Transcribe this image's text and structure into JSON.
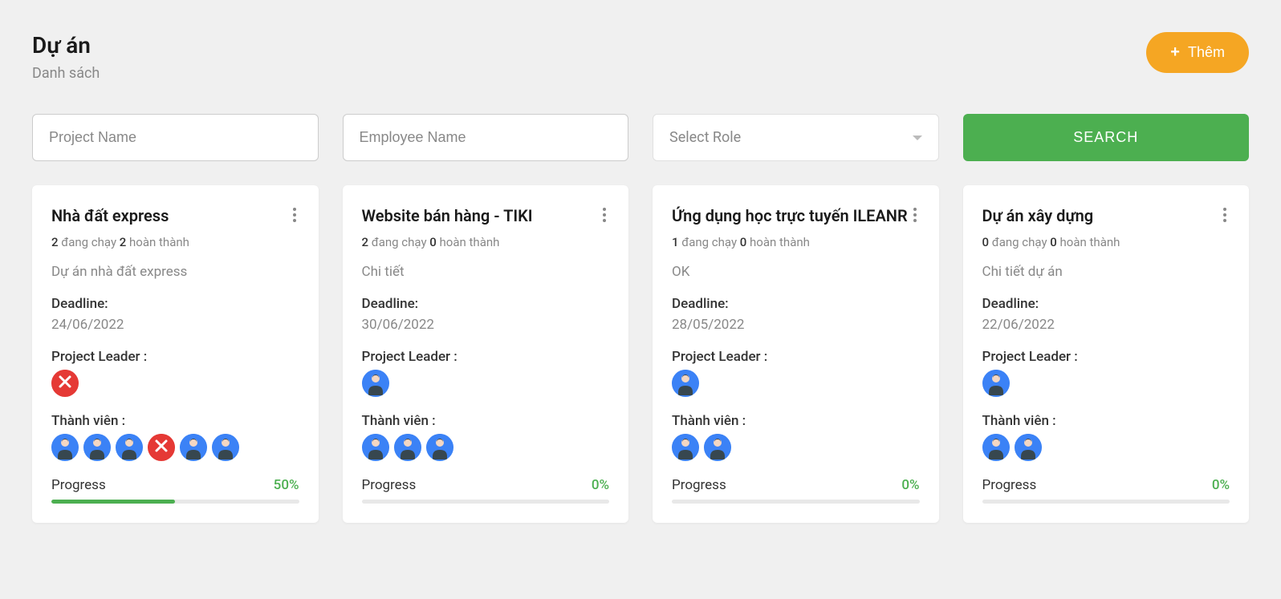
{
  "header": {
    "title": "Dự án",
    "subtitle": "Danh sách",
    "add_button": "Thêm"
  },
  "filters": {
    "project_name_placeholder": "Project Name",
    "employee_name_placeholder": "Employee Name",
    "role_placeholder": "Select Role",
    "search_button": "SEARCH"
  },
  "labels": {
    "deadline": "Deadline:",
    "project_leader": "Project Leader :",
    "members": "Thành viên :",
    "progress": "Progress",
    "running": "đang chạy",
    "completed": "hoàn thành"
  },
  "projects": [
    {
      "name": "Nhà đất express",
      "running": 2,
      "completed": 2,
      "description": "Dự án nhà đất express",
      "deadline": "24/06/2022",
      "leader": [
        {
          "type": "error"
        }
      ],
      "members": [
        {
          "type": "person"
        },
        {
          "type": "person"
        },
        {
          "type": "person"
        },
        {
          "type": "error"
        },
        {
          "type": "person"
        },
        {
          "type": "person"
        }
      ],
      "progress": 50
    },
    {
      "name": "Website bán hàng - TIKI",
      "running": 2,
      "completed": 0,
      "description": "Chi tiết",
      "deadline": "30/06/2022",
      "leader": [
        {
          "type": "person"
        }
      ],
      "members": [
        {
          "type": "person"
        },
        {
          "type": "person"
        },
        {
          "type": "person"
        }
      ],
      "progress": 0
    },
    {
      "name": "Ứng dụng học trực tuyến ILEANR",
      "running": 1,
      "completed": 0,
      "description": "OK",
      "deadline": "28/05/2022",
      "leader": [
        {
          "type": "person"
        }
      ],
      "members": [
        {
          "type": "person"
        },
        {
          "type": "person"
        }
      ],
      "progress": 0
    },
    {
      "name": "Dự án xây dựng",
      "running": 0,
      "completed": 0,
      "description": "Chi tiết dự án",
      "deadline": "22/06/2022",
      "leader": [
        {
          "type": "person"
        }
      ],
      "members": [
        {
          "type": "person"
        },
        {
          "type": "person"
        }
      ],
      "progress": 0
    }
  ]
}
